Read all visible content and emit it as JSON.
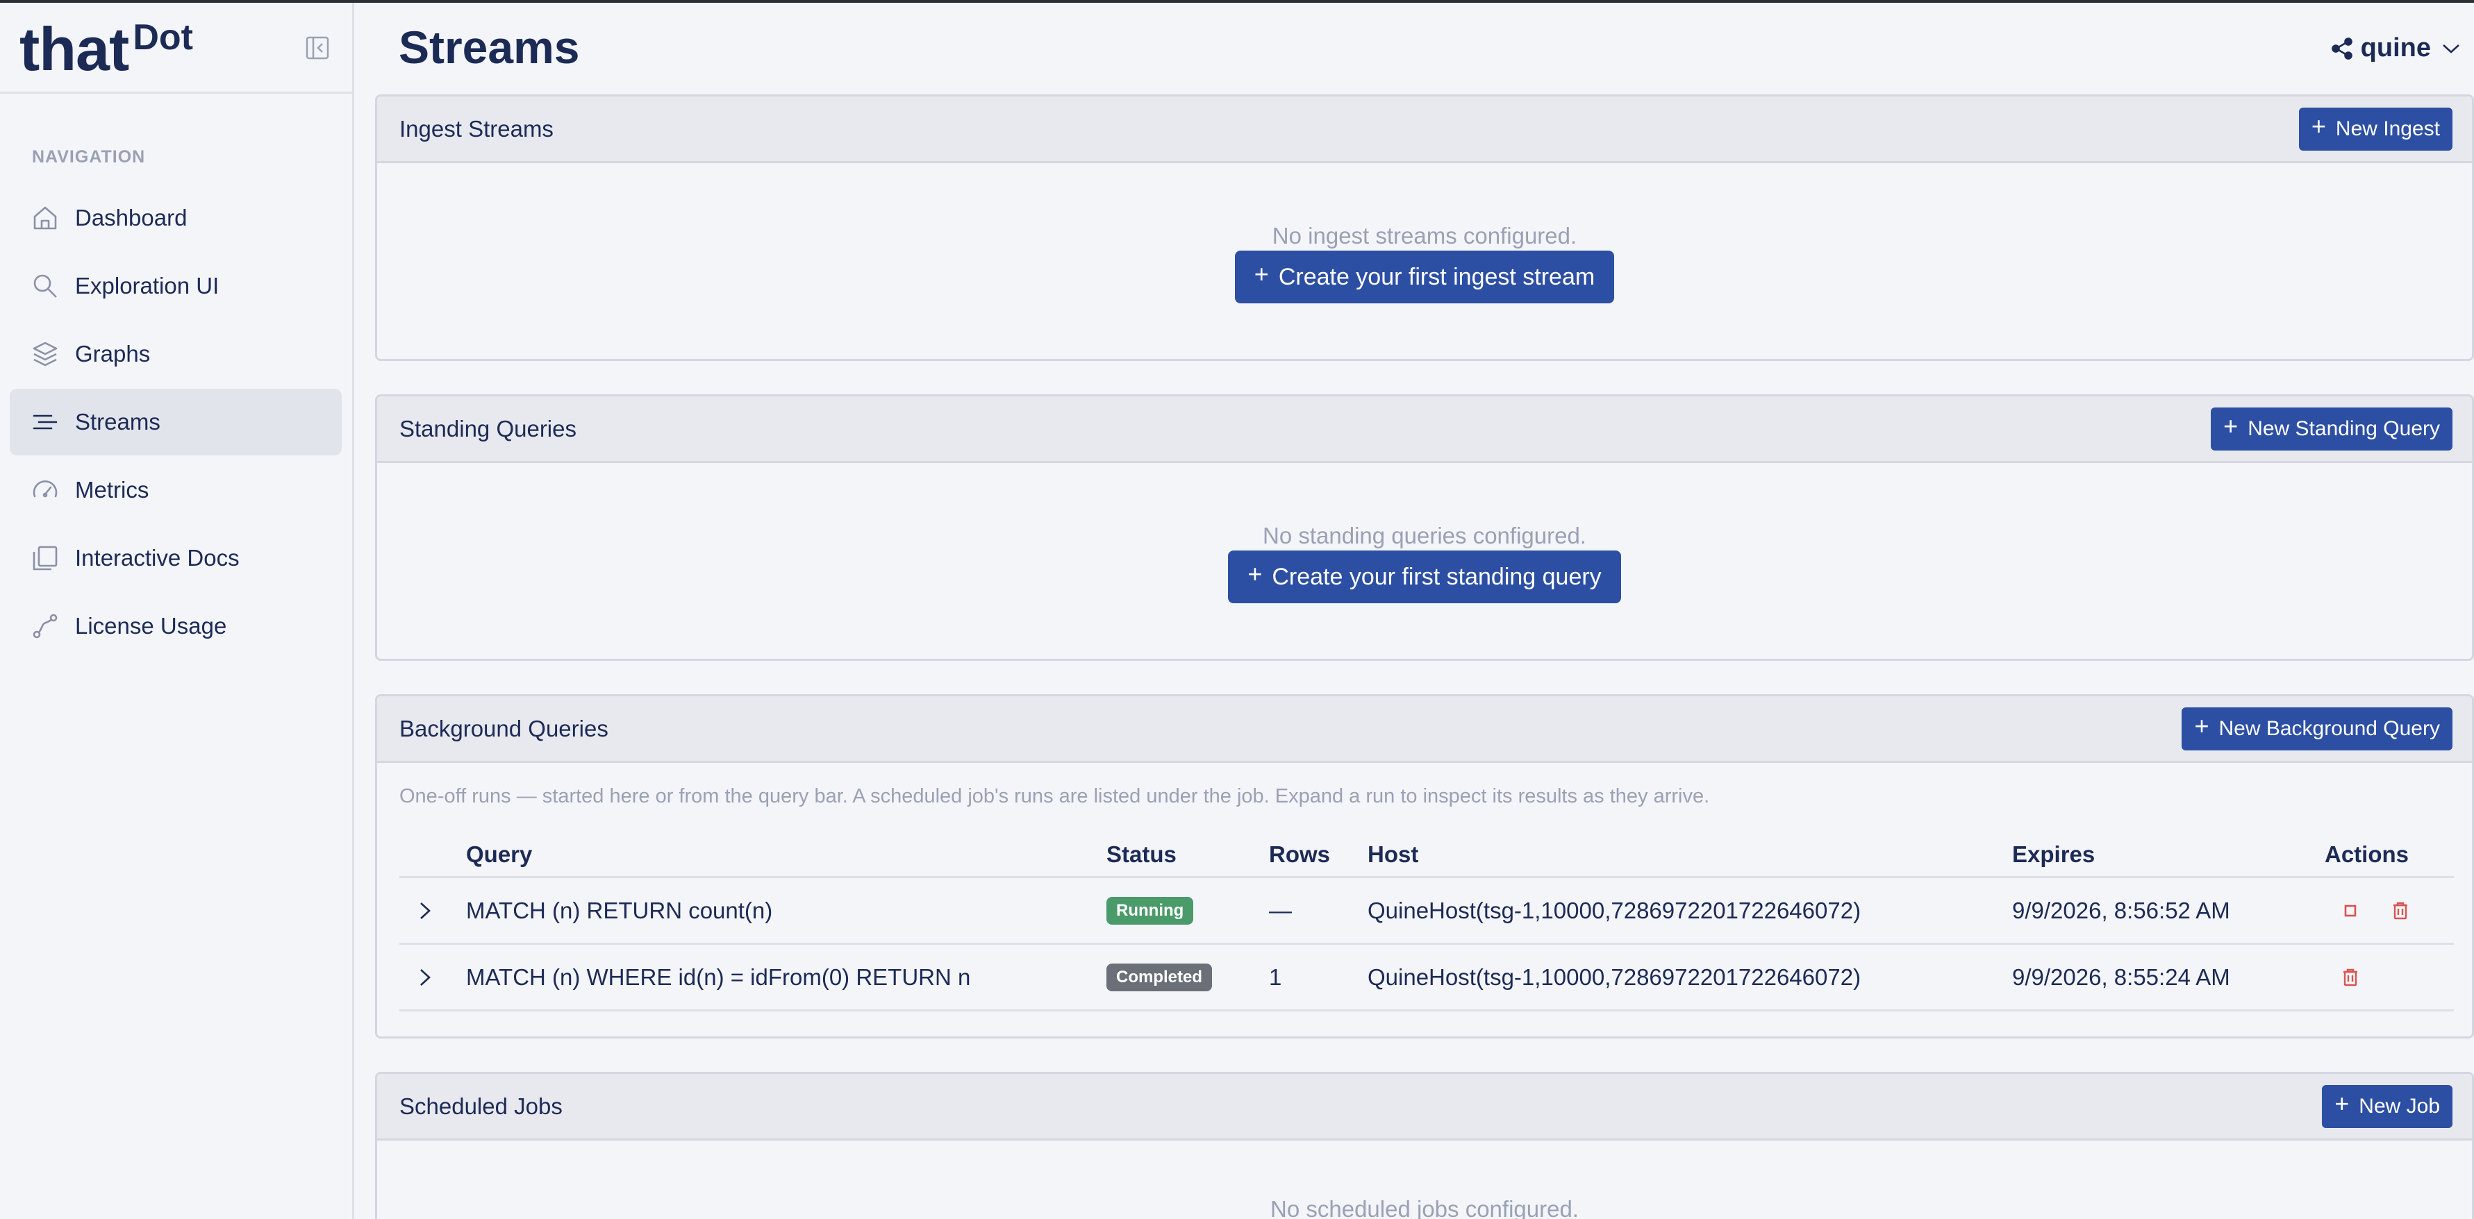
{
  "brand": {
    "that": "that",
    "dot": "Dot"
  },
  "sidebar": {
    "heading": "NAVIGATION",
    "items": [
      {
        "label": "Dashboard",
        "icon": "home-icon"
      },
      {
        "label": "Exploration UI",
        "icon": "search-icon"
      },
      {
        "label": "Graphs",
        "icon": "layers-icon"
      },
      {
        "label": "Streams",
        "icon": "streams-icon",
        "active": true
      },
      {
        "label": "Metrics",
        "icon": "gauge-icon"
      },
      {
        "label": "Interactive Docs",
        "icon": "docs-icon"
      },
      {
        "label": "License Usage",
        "icon": "license-icon"
      }
    ]
  },
  "header": {
    "title": "Streams",
    "user": "quine"
  },
  "ingest": {
    "title": "Ingest Streams",
    "new_button": "New Ingest",
    "empty_text": "No ingest streams configured.",
    "create_button": "Create your first ingest stream"
  },
  "standing": {
    "title": "Standing Queries",
    "new_button": "New Standing Query",
    "empty_text": "No standing queries configured.",
    "create_button": "Create your first standing query"
  },
  "background": {
    "title": "Background Queries",
    "new_button": "New Background Query",
    "hint": "One-off runs — started here or from the query bar. A scheduled job's runs are listed under the job. Expand a run to inspect its results as they arrive.",
    "columns": {
      "query": "Query",
      "status": "Status",
      "rows": "Rows",
      "host": "Host",
      "expires": "Expires",
      "actions": "Actions"
    },
    "rows": [
      {
        "query": "MATCH (n) RETURN count(n)",
        "status": "Running",
        "rows": "—",
        "host": "QuineHost(tsg-1,10000,7286972201722646072)",
        "expires": "9/9/2026, 8:56:52 AM"
      },
      {
        "query": "MATCH (n) WHERE id(n) = idFrom(0) RETURN n",
        "status": "Completed",
        "rows": "1",
        "host": "QuineHost(tsg-1,10000,7286972201722646072)",
        "expires": "9/9/2026, 8:55:24 AM"
      }
    ]
  },
  "scheduled": {
    "title": "Scheduled Jobs",
    "new_button": "New Job",
    "empty_text": "No scheduled jobs configured."
  },
  "colors": {
    "primary": "#2c4fa3",
    "running": "#4a9a6a",
    "completed": "#6b6f77",
    "danger": "#d9534f",
    "text": "#1c2a56",
    "muted": "#9aa1b4"
  }
}
